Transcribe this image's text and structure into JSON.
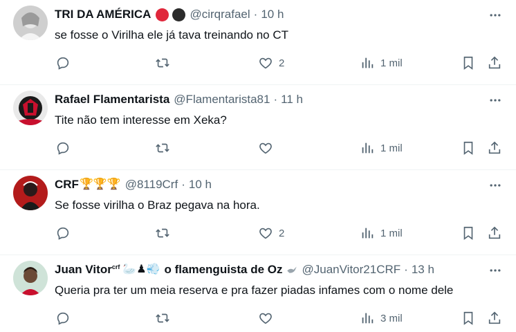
{
  "tweets": [
    {
      "name": "TRI DA AMÉRICA",
      "handle": "@cirqrafael",
      "time": "10 h",
      "text": "se fosse o Virilha ele já tava treinando no CT",
      "likes": "2",
      "views": "1 mil",
      "badge_colors": [
        "#e0273b",
        "#2b2b2b"
      ]
    },
    {
      "name": "Rafael Flamentarista",
      "handle": "@Flamentarista81",
      "time": "11 h",
      "text": "Tite não tem interesse em Xeka?",
      "likes": "",
      "views": "1 mil"
    },
    {
      "name": "CRF",
      "name_emoji": "🏆🏆🏆",
      "handle": "@8119Crf",
      "time": "10 h",
      "text": "Se fosse virilha o Braz pegava na hora.",
      "likes": "2",
      "views": "1 mil"
    },
    {
      "name": "Juan Vitor",
      "name_sup": "crf",
      "name_emoji": "🦢♟💨",
      "name_suffix": "o flamenguista de Oz",
      "handle": "@JuanVitor21CRF",
      "time": "13 h",
      "text": "Queria pra ter um meia reserva e pra fazer piadas infames com o nome dele",
      "likes": "",
      "views": "3 mil"
    }
  ],
  "separator": "·",
  "icons": {
    "reply": "reply-icon",
    "retweet": "retweet-icon",
    "like": "heart-icon",
    "views": "views-icon",
    "bookmark": "bookmark-icon",
    "share": "share-icon",
    "more": "more-icon"
  },
  "colors": {
    "text": "#0f1419",
    "secondary": "#536471",
    "divider": "#eff3f4"
  }
}
